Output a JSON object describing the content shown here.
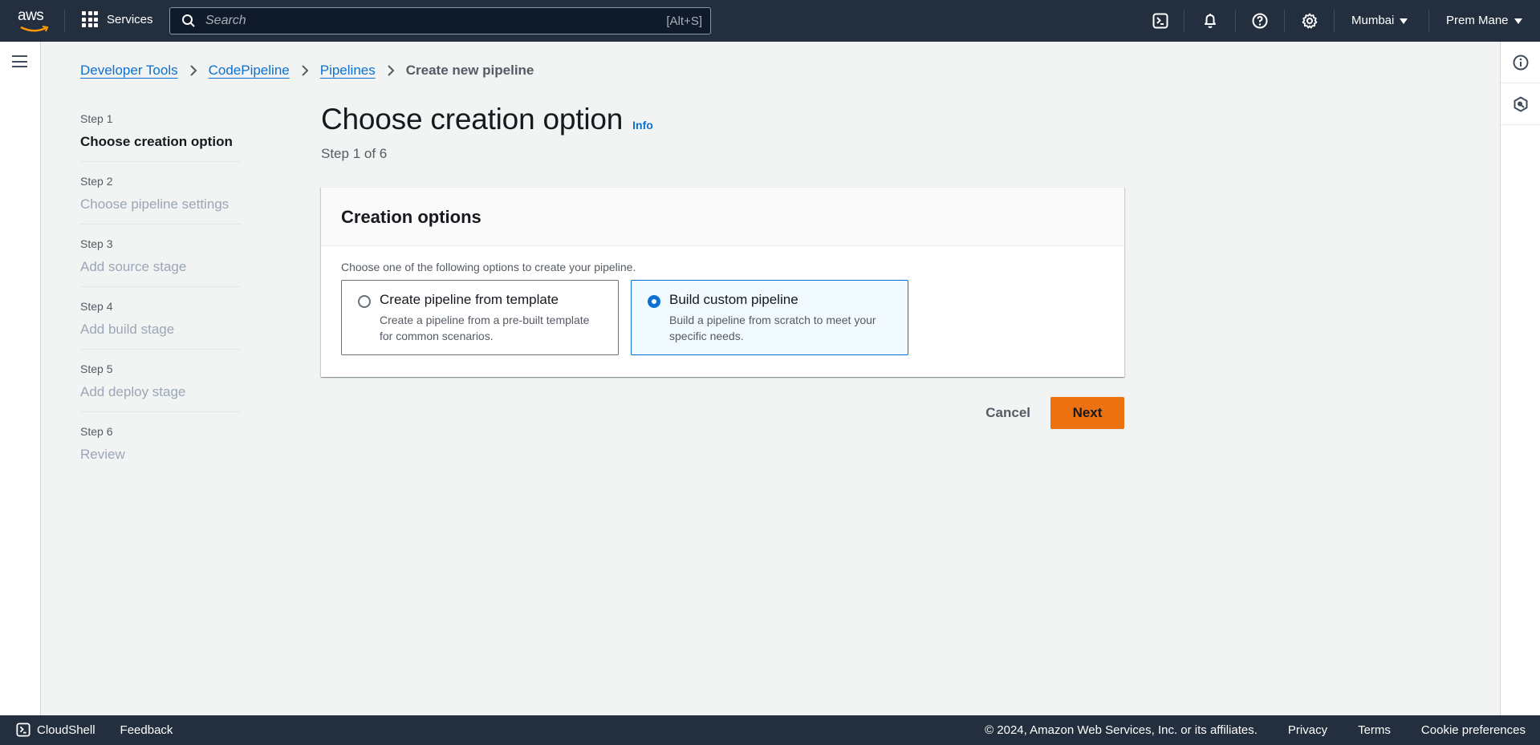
{
  "topnav": {
    "logo_text": "aws",
    "services_label": "Services",
    "search_placeholder": "Search",
    "search_shortcut": "[Alt+S]",
    "region": "Mumbai",
    "user": "Prem Mane",
    "icons": [
      "cloudshell-icon",
      "notifications-bell-icon",
      "help-icon",
      "settings-gear-icon"
    ]
  },
  "breadcrumb": {
    "items": [
      {
        "label": "Developer Tools",
        "link": true
      },
      {
        "label": "CodePipeline",
        "link": true
      },
      {
        "label": "Pipelines",
        "link": true
      },
      {
        "label": "Create new pipeline",
        "link": false
      }
    ]
  },
  "steps": [
    {
      "number": "Step 1",
      "title": "Choose creation option",
      "active": true
    },
    {
      "number": "Step 2",
      "title": "Choose pipeline settings",
      "active": false
    },
    {
      "number": "Step 3",
      "title": "Add source stage",
      "active": false
    },
    {
      "number": "Step 4",
      "title": "Add build stage",
      "active": false
    },
    {
      "number": "Step 5",
      "title": "Add deploy stage",
      "active": false
    },
    {
      "number": "Step 6",
      "title": "Review",
      "active": false
    }
  ],
  "main": {
    "title": "Choose creation option",
    "info_label": "Info",
    "subtitle": "Step 1 of 6",
    "panel": {
      "header": "Creation options",
      "description": "Choose one of the following options to create your pipeline.",
      "options": [
        {
          "title": "Create pipeline from template",
          "description": "Create a pipeline from a pre-built template for common scenarios.",
          "selected": false
        },
        {
          "title": "Build custom pipeline",
          "description": "Build a pipeline from scratch to meet your specific needs.",
          "selected": true
        }
      ]
    },
    "cancel_label": "Cancel",
    "next_label": "Next"
  },
  "colors": {
    "nav_bg": "#232f3e",
    "link": "#0972d3",
    "primary_button": "#ec7211",
    "selected_tile_bg": "#f1faff"
  },
  "footer": {
    "cloudshell_label": "CloudShell",
    "feedback_label": "Feedback",
    "copyright": "© 2024, Amazon Web Services, Inc. or its affiliates.",
    "privacy": "Privacy",
    "terms": "Terms",
    "cookie": "Cookie preferences"
  }
}
